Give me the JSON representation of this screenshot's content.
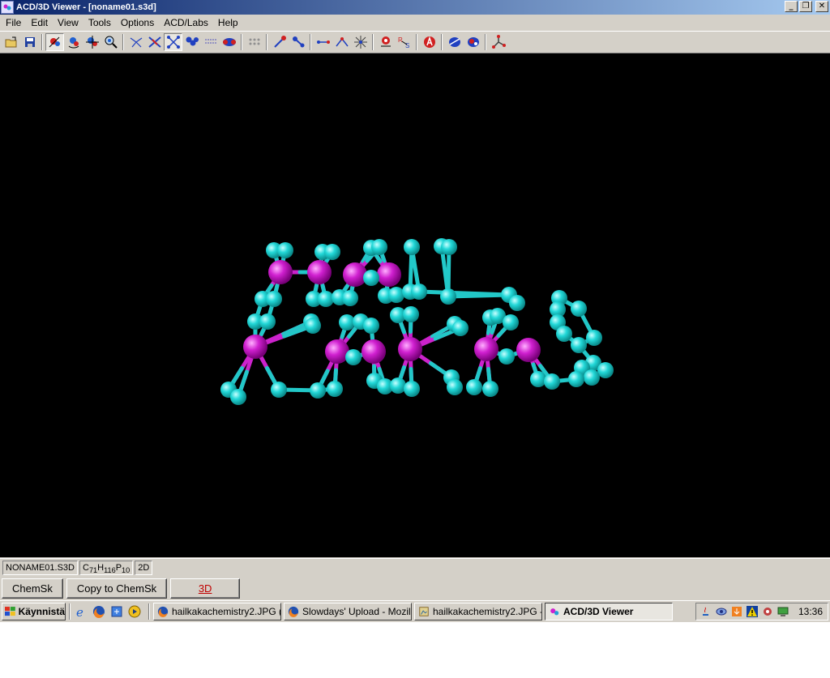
{
  "window": {
    "title": "ACD/3D Viewer - [noname01.s3d]"
  },
  "menu": [
    "File",
    "Edit",
    "View",
    "Tools",
    "Options",
    "ACD/Labs",
    "Help"
  ],
  "toolbar_icons": [
    "open-icon",
    "save-icon",
    "rotate-icon",
    "rotate-3d-icon",
    "move-icon",
    "zoom-icon",
    "wire-icon",
    "stick-icon",
    "ball-stick-icon",
    "spacefill-icon",
    "dots-icon",
    "cpk-icon",
    "surface-icon",
    "measure-distance-icon",
    "measure-angle-icon",
    "bond-icon",
    "angle-icon",
    "torsion-icon",
    "hydrogen-icon",
    "rs-stereo-icon",
    "labels-icon",
    "orbital-icon",
    "orbital-color-icon",
    "axes-icon"
  ],
  "status": {
    "filename": "NONAME01.S3D",
    "formula": {
      "c": "C",
      "c_n": "71",
      "h": "H",
      "h_n": "116",
      "p": "P",
      "p_n": "10"
    },
    "mode": "2D"
  },
  "buttons": {
    "chemsk": "ChemSk",
    "copy": "Copy to ChemSk",
    "threed": "3D"
  },
  "taskbar": {
    "start": "Käynnistä",
    "tasks": [
      {
        "label": "hailkakachemistry2.JPG (..."
      },
      {
        "label": "Slowdays' Upload - Mozill..."
      },
      {
        "label": "hailkakachemistry2.JPG -..."
      },
      {
        "label": "ACD/3D Viewer"
      }
    ],
    "clock": "13:36"
  },
  "colors": {
    "carbon": "#22d8d8",
    "phosphorus": "#d020d0",
    "background": "#000000"
  }
}
